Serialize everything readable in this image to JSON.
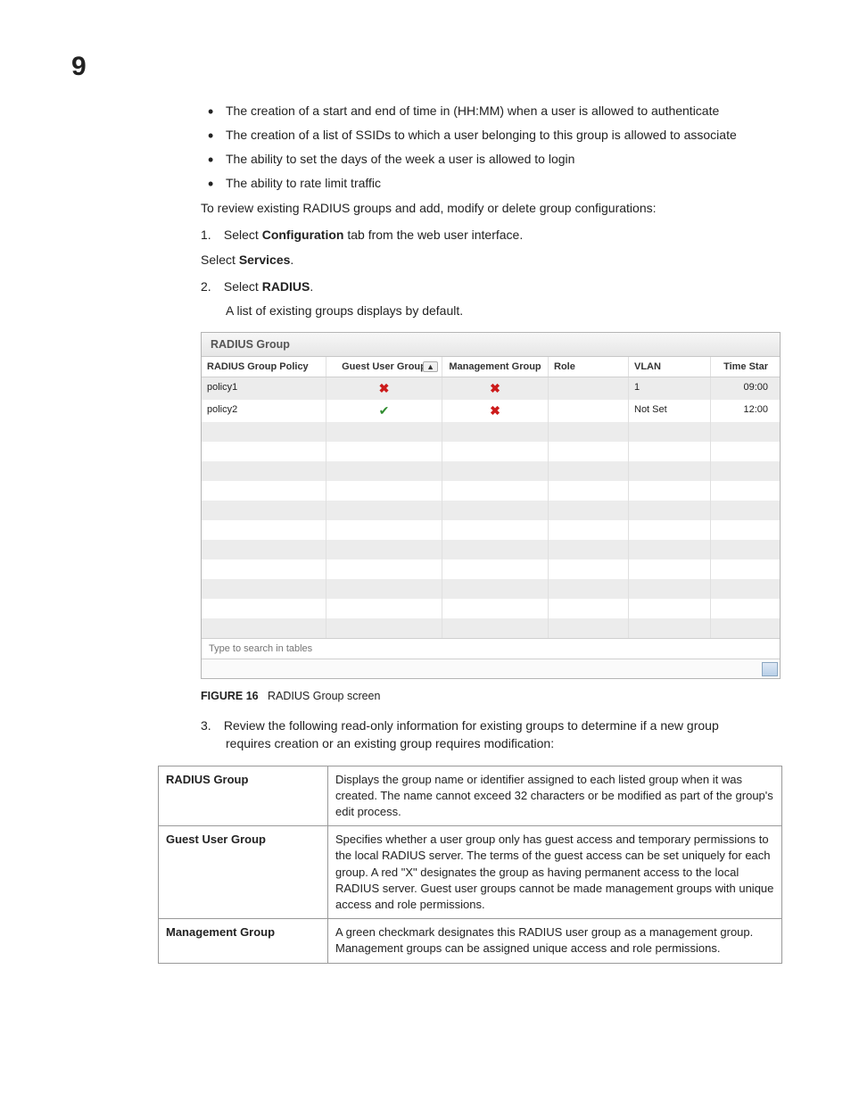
{
  "chapter": "9",
  "bullets": [
    "The creation of a start and end of time in (HH:MM) when a user is allowed to authenticate",
    "The creation of a list of SSIDs to which a user belonging to this group is allowed to associate",
    "The ability to set the days of the week a user is allowed to login",
    "The ability to rate limit traffic"
  ],
  "intro_para": "To review existing RADIUS groups and add, modify or delete group configurations:",
  "step1_prefix": "1.",
  "step1_a": "Select ",
  "step1_bold": "Configuration",
  "step1_b": " tab from the web user interface.",
  "select_services_a": "Select ",
  "select_services_bold": "Services",
  "select_services_b": ".",
  "step2_prefix": "2.",
  "step2_a": "Select ",
  "step2_bold": "RADIUS",
  "step2_b": ".",
  "step2_note": "A list of existing groups displays by default.",
  "panel": {
    "title": "RADIUS Group",
    "columns": {
      "policy": "RADIUS Group Policy",
      "guest": "Guest User Group",
      "mgmt": "Management Group",
      "role": "Role",
      "vlan": "VLAN",
      "time": "Time Star"
    },
    "rows": [
      {
        "policy": "policy1",
        "guest": "x",
        "mgmt": "x",
        "role": "",
        "vlan": "1",
        "time": "09:00"
      },
      {
        "policy": "policy2",
        "guest": "check",
        "mgmt": "x",
        "role": "",
        "vlan": "Not Set",
        "time": "12:00"
      }
    ],
    "search_placeholder": "Type to search in tables"
  },
  "figure_label": "FIGURE 16",
  "figure_caption": "RADIUS Group screen",
  "step3_prefix": "3.",
  "step3_line1": "Review the following read-only information for existing groups to determine if a new group",
  "step3_line2": "requires creation or an existing group requires modification:",
  "definitions": [
    {
      "term": "RADIUS Group",
      "desc": "Displays the group name or identifier assigned to each listed group when it was created. The name cannot exceed 32 characters or be modified as part of the group's edit process."
    },
    {
      "term": "Guest User Group",
      "desc": "Specifies whether a user group only has guest access and temporary permissions to the local RADIUS server. The terms of the guest access can be set uniquely for each group. A red \"X\" designates the group as having permanent access to the local RADIUS server. Guest user groups cannot be made management groups with unique access and role permissions."
    },
    {
      "term": "Management Group",
      "desc": "A green checkmark designates this RADIUS user group as a management group. Management groups can be assigned unique access and role permissions."
    }
  ]
}
